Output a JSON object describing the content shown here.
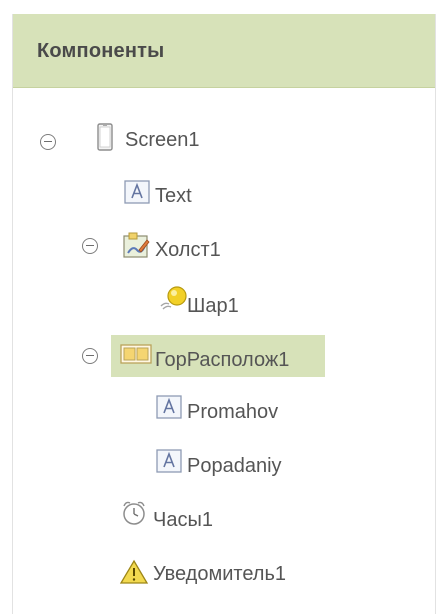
{
  "header": {
    "title": "Компоненты"
  },
  "tree": {
    "nodes": [
      {
        "label": "Screen1",
        "icon": "screen-icon",
        "toggle": "collapse"
      },
      {
        "label": "Text",
        "icon": "label-icon"
      },
      {
        "label": "Холст1",
        "icon": "canvas-icon",
        "toggle": "collapse"
      },
      {
        "label": "Шар1",
        "icon": "ball-sprite-icon"
      },
      {
        "label": "ГорРасполож1",
        "icon": "horizontal-arrangement-icon",
        "toggle": "collapse",
        "selected": true
      },
      {
        "label": "Promahov",
        "icon": "label-icon"
      },
      {
        "label": "Popadaniy",
        "icon": "label-icon"
      },
      {
        "label": "Часы1",
        "icon": "clock-icon"
      },
      {
        "label": "Уведомитель1",
        "icon": "notifier-icon"
      }
    ]
  },
  "colors": {
    "header_bg": "#d7e2b9",
    "selected_bg": "#d7e2b9",
    "text": "#555555"
  }
}
